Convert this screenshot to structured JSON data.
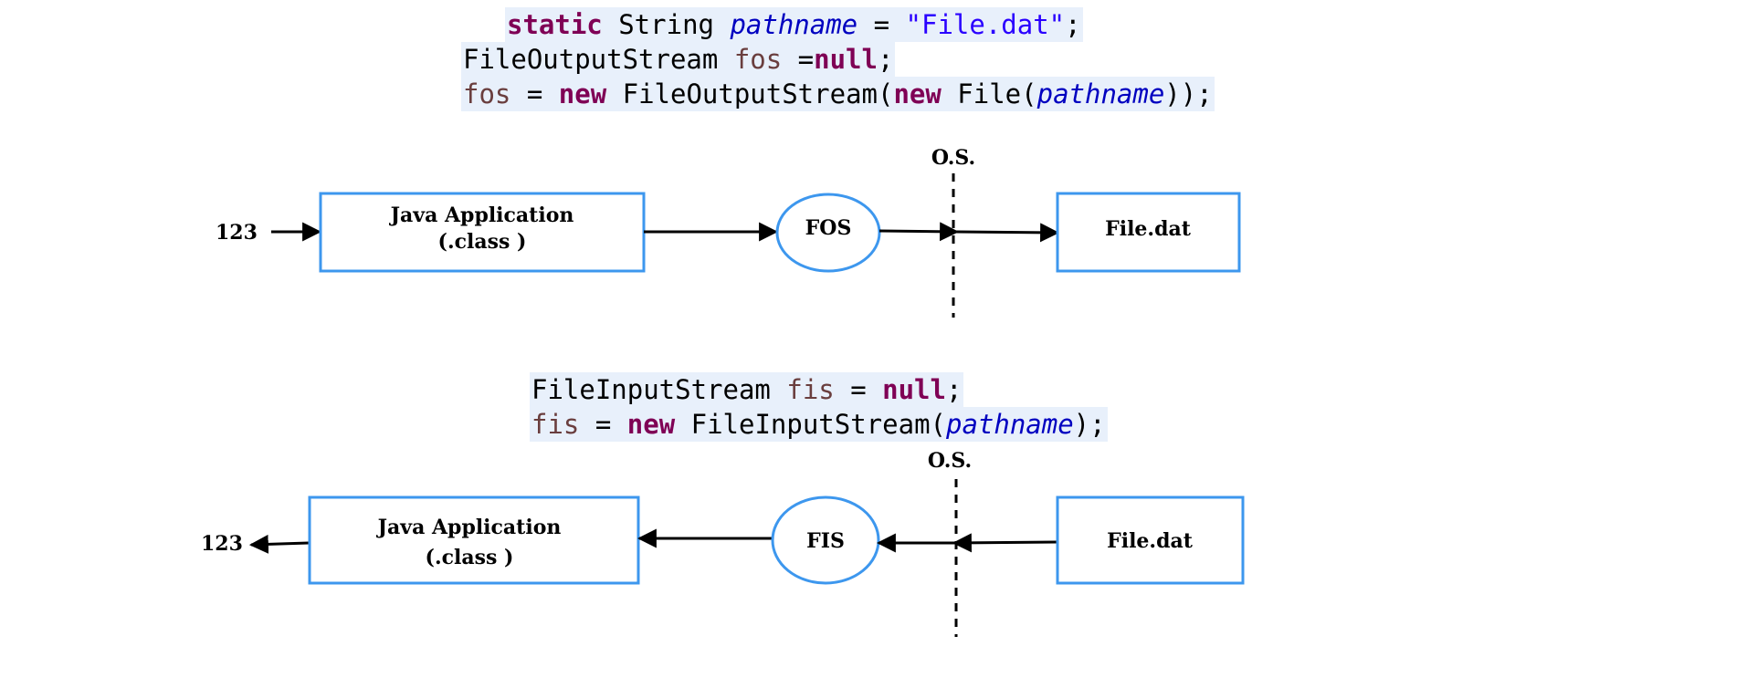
{
  "code_top": {
    "line1": {
      "kw": "static",
      "type": " String ",
      "field": "pathname",
      "eq": " = ",
      "str": "\"File.dat\"",
      "end": ";"
    },
    "line2": {
      "type": "FileOutputStream ",
      "var": "fos",
      "eq": " =",
      "kw": "null",
      "end": ";"
    },
    "line3": {
      "var": "fos",
      "eq": " = ",
      "kw1": "new",
      "t1": " FileOutputStream(",
      "kw2": "new",
      "t2": " File(",
      "field": "pathname",
      "end": "));"
    }
  },
  "code_bottom": {
    "line1": {
      "type": "FileInputStream ",
      "var": "fis",
      "eq": " = ",
      "kw": "null",
      "end": ";"
    },
    "line2": {
      "var": "fis",
      "eq": " = ",
      "kw": "new",
      "t1": " FileInputStream(",
      "field": "pathname",
      "end": ");"
    }
  },
  "diagram_top": {
    "input_value": "123",
    "app_line1": "Java Application",
    "app_line2": "(.class )",
    "stream": "FOS",
    "os_label": "O.S.",
    "file": "File.dat"
  },
  "diagram_bottom": {
    "output_value": "123",
    "app_line1": "Java Application",
    "app_line2": "(.class )",
    "stream": "FIS",
    "os_label": "O.S.",
    "file": "File.dat"
  },
  "colors": {
    "box_border": "#3d97ee",
    "keyword": "#7f0055",
    "string": "#2a00ff",
    "field": "#0000c0",
    "variable": "#6a3e3e",
    "code_bg": "#e8f0fb"
  }
}
